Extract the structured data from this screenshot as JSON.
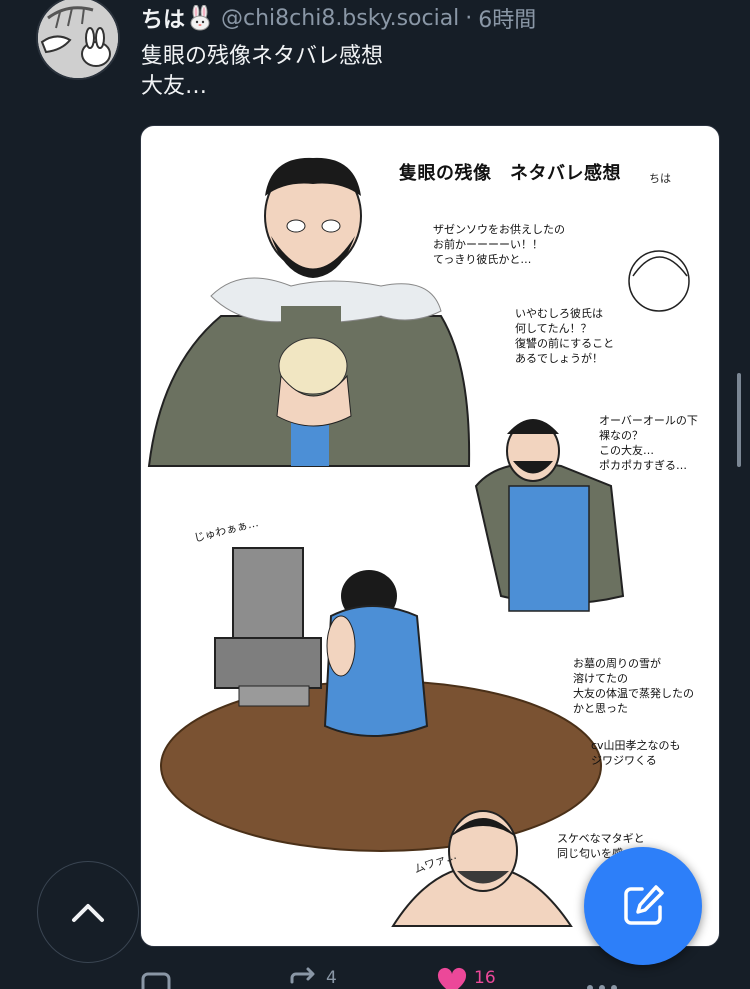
{
  "post": {
    "display_name": "ちは",
    "handle": "@chi8chi8.bsky.social",
    "separator": "·",
    "time": "6時間",
    "text_line1": "隻眼の残像ネタバレ感想",
    "text_line2": "大友…"
  },
  "image": {
    "title": "隻眼の残像　ネタバレ感想",
    "signature": "ちは",
    "note1": "ザゼンソウをお供えしたの\nお前かーーーーい！！\nてっきり彼氏かと…",
    "note2": "いやむしろ彼氏は\n何してたん！？\n復讐の前にすること\nあるでしょうが！",
    "note3": "オーバーオールの下\n裸なの？\nこの大友…\nポカポカすぎる…",
    "note4": "お墓の周りの雪が\n溶けてたの\n大友の体温で蒸発したの\nかと思った",
    "note5": "cv山田孝之なのも\nジワジワくる",
    "note6": "スケベなマタギと\n同じ匂いを感",
    "sfx1": "じゅわぁぁ…",
    "sfx2": "ムワァ…"
  },
  "actions": {
    "reply_count": "",
    "repost_count": "4",
    "like_count": "16"
  },
  "colors": {
    "background": "#161e27",
    "handle": "#8a97a6",
    "compose_button": "#2d7ff9",
    "like": "#ec4899"
  },
  "icons": {
    "scroll_top": "chevron-up-icon",
    "compose": "compose-icon",
    "reply": "reply-icon",
    "repost": "repost-icon",
    "like": "heart-icon",
    "more": "more-icon"
  }
}
